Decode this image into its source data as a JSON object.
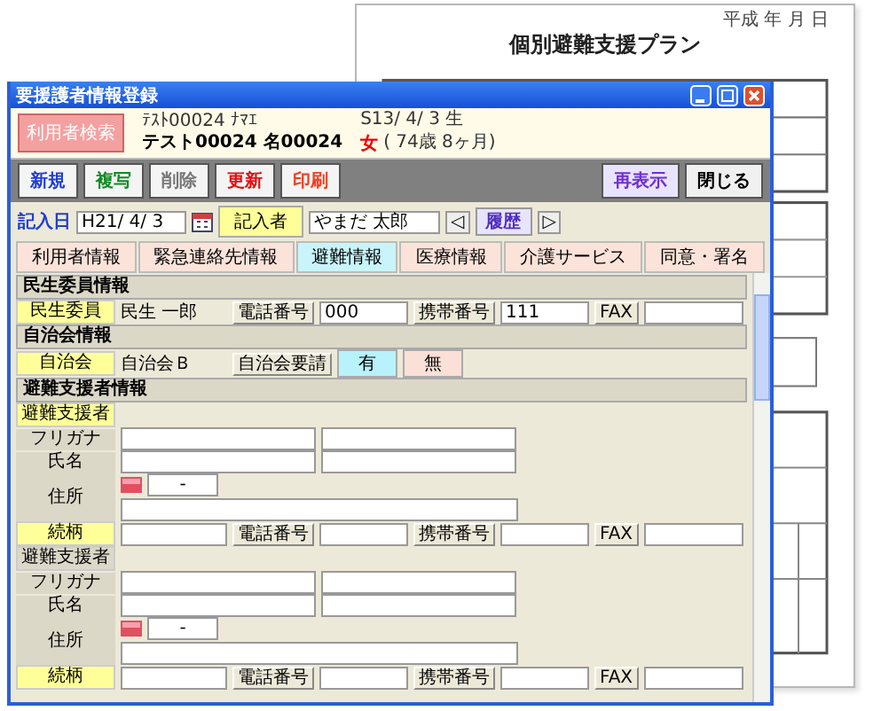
{
  "document": {
    "date": "平成 年 月 日",
    "title": "個別避難支援プラン"
  },
  "window": {
    "title": "要援護者情報登録"
  },
  "search_button": "利用者検索",
  "patient": {
    "kana": "ﾃｽﾄ00024 ﾅﾏｴ",
    "name": "テスト00024 名00024",
    "birth": "S13/ 4/ 3 生",
    "sex": "女",
    "age": "( 74歳 8ヶ月)"
  },
  "toolbar": [
    {
      "label": "新規",
      "color": "#1f3fd0"
    },
    {
      "label": "複写",
      "color": "#118a22"
    },
    {
      "label": "削除",
      "color": "#777777"
    },
    {
      "label": "更新",
      "color": "#e01010"
    },
    {
      "label": "印刷",
      "color": "#f04020"
    }
  ],
  "right_buttons": [
    {
      "label": "再表示",
      "kind": "redisplay"
    },
    {
      "label": "閉じる",
      "kind": "close"
    }
  ],
  "entry": {
    "date_label": "記入日",
    "date": "H21/ 4/ 3",
    "writer_button": "記入者",
    "writer": "やまだ 太郎",
    "prev": "◁",
    "history": "履歴",
    "next": "▷"
  },
  "tabs": [
    {
      "label": "利用者情報",
      "selected": false
    },
    {
      "label": "緊急連絡先情報",
      "selected": false
    },
    {
      "label": "避難情報",
      "selected": true
    },
    {
      "label": "医療情報",
      "selected": false
    },
    {
      "label": "介護サービス",
      "selected": false
    },
    {
      "label": "同意・署名",
      "selected": false
    }
  ],
  "rows": [
    {
      "kind": "header",
      "label": "民生委員情報"
    },
    {
      "kind": "contact",
      "label": "民生委員",
      "value": "民生 一郎",
      "fields": [
        {
          "label": "電話番号",
          "value": "000"
        },
        {
          "label": "携帯番号",
          "value": "111"
        },
        {
          "label": "FAX"
        }
      ]
    },
    {
      "kind": "header",
      "label": "自治会情報"
    },
    {
      "kind": "toggle",
      "label": "自治会",
      "value": "自治会Ｂ",
      "toggle_label": "自治会要請",
      "options": [
        {
          "label": "有",
          "selected": true
        },
        {
          "label": "無",
          "selected": false
        }
      ]
    },
    {
      "kind": "header",
      "label": "避難支援者情報"
    },
    {
      "kind": "tag",
      "label": "避難支援者",
      "highlight": true
    },
    {
      "kind": "pair",
      "label": "フリガナ"
    },
    {
      "kind": "pair",
      "label": "氏名"
    },
    {
      "kind": "address",
      "label": "住所",
      "postal": "-"
    },
    {
      "kind": "contact",
      "label": "続柄",
      "fields": [
        {
          "label": "電話番号"
        },
        {
          "label": "携帯番号"
        },
        {
          "label": "FAX"
        }
      ]
    },
    {
      "kind": "tag",
      "label": "避難支援者",
      "highlight": false
    },
    {
      "kind": "pair",
      "label": "フリガナ"
    },
    {
      "kind": "pair",
      "label": "氏名"
    },
    {
      "kind": "address",
      "label": "住所",
      "postal": "-"
    },
    {
      "kind": "contact",
      "label": "続柄",
      "fields": [
        {
          "label": "電話番号"
        },
        {
          "label": "携帯番号"
        },
        {
          "label": "FAX"
        }
      ]
    }
  ]
}
